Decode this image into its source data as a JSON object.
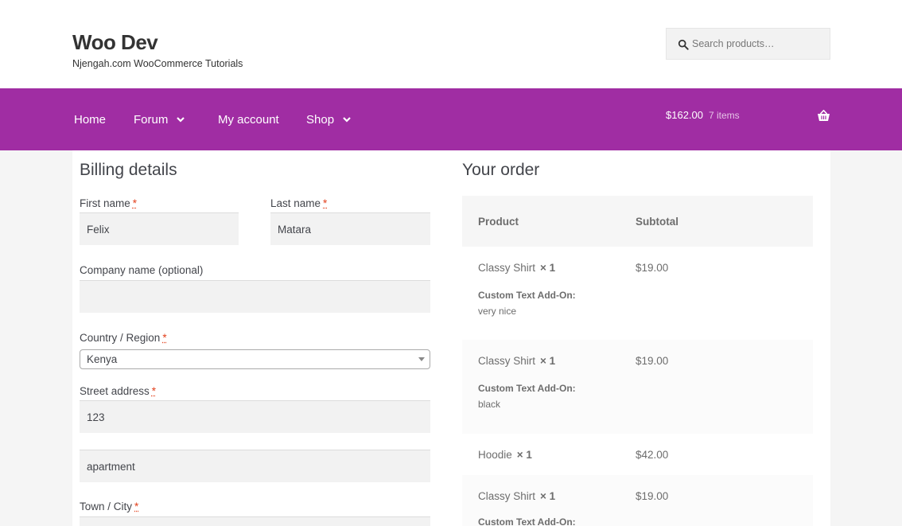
{
  "header": {
    "site_title": "Woo Dev",
    "site_description": "Njengah.com WooCommerce Tutorials",
    "search_placeholder": "Search products…"
  },
  "nav": {
    "items": [
      {
        "label": "Home",
        "has_dropdown": false
      },
      {
        "label": "Forum",
        "has_dropdown": true
      },
      {
        "label": "My account",
        "has_dropdown": false
      },
      {
        "label": "Shop",
        "has_dropdown": true
      }
    ],
    "cart_total": "$162.00",
    "cart_count": "7 items"
  },
  "colors": {
    "accent": "#a02da3",
    "required": "#e2401c"
  },
  "billing": {
    "title": "Billing details",
    "first_name_label": "First name",
    "first_name_value": "Felix",
    "last_name_label": "Last name",
    "last_name_value": "Matara",
    "company_label": "Company name (optional)",
    "company_value": "",
    "country_label": "Country / Region",
    "country_value": "Kenya",
    "street_label": "Street address",
    "street_value": "123",
    "street2_value": "apartment",
    "city_label": "Town / City",
    "required_mark": "*"
  },
  "order": {
    "title": "Your order",
    "col_product": "Product",
    "col_subtotal": "Subtotal",
    "rows": [
      {
        "product": "Classy Shirt",
        "qty": "× 1",
        "subtotal": "$19.00",
        "meta_key": "Custom Text Add-On:",
        "meta_value": "very nice"
      },
      {
        "product": "Classy Shirt",
        "qty": "× 1",
        "subtotal": "$19.00",
        "meta_key": "Custom Text Add-On:",
        "meta_value": "black"
      },
      {
        "product": "Hoodie",
        "qty": "× 1",
        "subtotal": "$42.00"
      },
      {
        "product": "Classy Shirt",
        "qty": "× 1",
        "subtotal": "$19.00",
        "meta_key": "Custom Text Add-On:"
      }
    ]
  }
}
